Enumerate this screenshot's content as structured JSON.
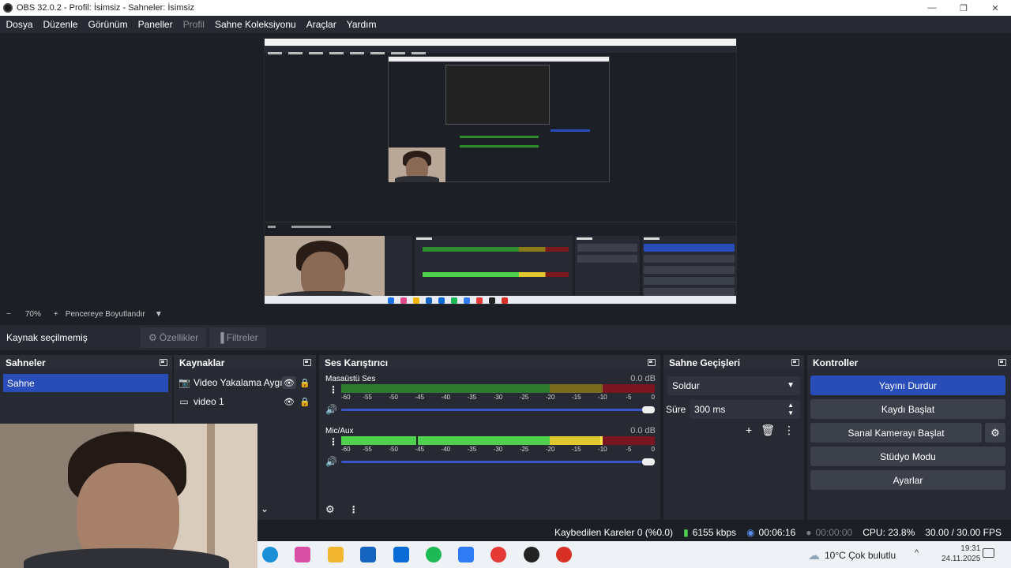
{
  "window": {
    "title": "OBS 32.0.2 - Profil: İsimsiz - Sahneler: İsimsiz",
    "controls": {
      "minimize": "—",
      "restore": "❐",
      "close": "✕"
    }
  },
  "menu": [
    "Dosya",
    "Düzenle",
    "Görünüm",
    "Paneller",
    "Profil",
    "Sahne Koleksiyonu",
    "Araçlar",
    "Yardım"
  ],
  "zoom_bar": {
    "minus": "−",
    "zoom": "70%",
    "plus": "+",
    "fit": "Pencereye Boyutlandır"
  },
  "source_toolbar": {
    "label": "Kaynak seçilmemiş",
    "properties": "Özellikler",
    "filters": "Filtreler"
  },
  "scenes": {
    "title": "Sahneler",
    "items": [
      "Sahne"
    ]
  },
  "sources": {
    "title": "Kaynaklar",
    "items": [
      {
        "name": "Video Yakalama Aygıtı",
        "icon": "camera-icon",
        "visible": true,
        "locked": false
      },
      {
        "name": "video 1",
        "icon": "display-icon",
        "visible": true,
        "locked": true
      }
    ]
  },
  "mixer": {
    "title": "Ses Karıştırıcı",
    "ticks": [
      "-60",
      "-55",
      "-50",
      "-45",
      "-40",
      "-35",
      "-30",
      "-25",
      "-20",
      "-15",
      "-10",
      "-5",
      "0"
    ],
    "channels": [
      {
        "name": "Masaüstü Ses",
        "db": "0.0 dB",
        "level": 0.0,
        "volume": 1.0
      },
      {
        "name": "Mic/Aux",
        "db": "0.0 dB",
        "level": 0.84,
        "volume": 1.0
      }
    ]
  },
  "transitions": {
    "title": "Sahne Geçişleri",
    "selected": "Soldur",
    "duration_label": "Süre",
    "duration": "300 ms"
  },
  "controls": {
    "title": "Kontroller",
    "buttons": [
      "Yayını Durdur",
      "Kaydı Başlat",
      "Sanal Kamerayı Başlat",
      "Stüdyo Modu",
      "Ayarlar"
    ]
  },
  "status": {
    "dropped": "Kaybedilen Kareler 0 (%0.0)",
    "bitrate": "6155 kbps",
    "stream_time": "00:06:16",
    "record_time": "00:00:00",
    "cpu": "CPU: 23.8%",
    "fps": "30.00 / 30.00 FPS"
  },
  "taskbar": {
    "weather": "10°C  Çok bulutlu",
    "time": "19:31",
    "date": "24.11.2025"
  },
  "colors": {
    "accent": "#284cb8",
    "panel": "#272a33",
    "background": "#1d1f26",
    "meter_green": "#4fd14f",
    "meter_yellow": "#e0c830",
    "meter_red": "#d12e2e"
  }
}
